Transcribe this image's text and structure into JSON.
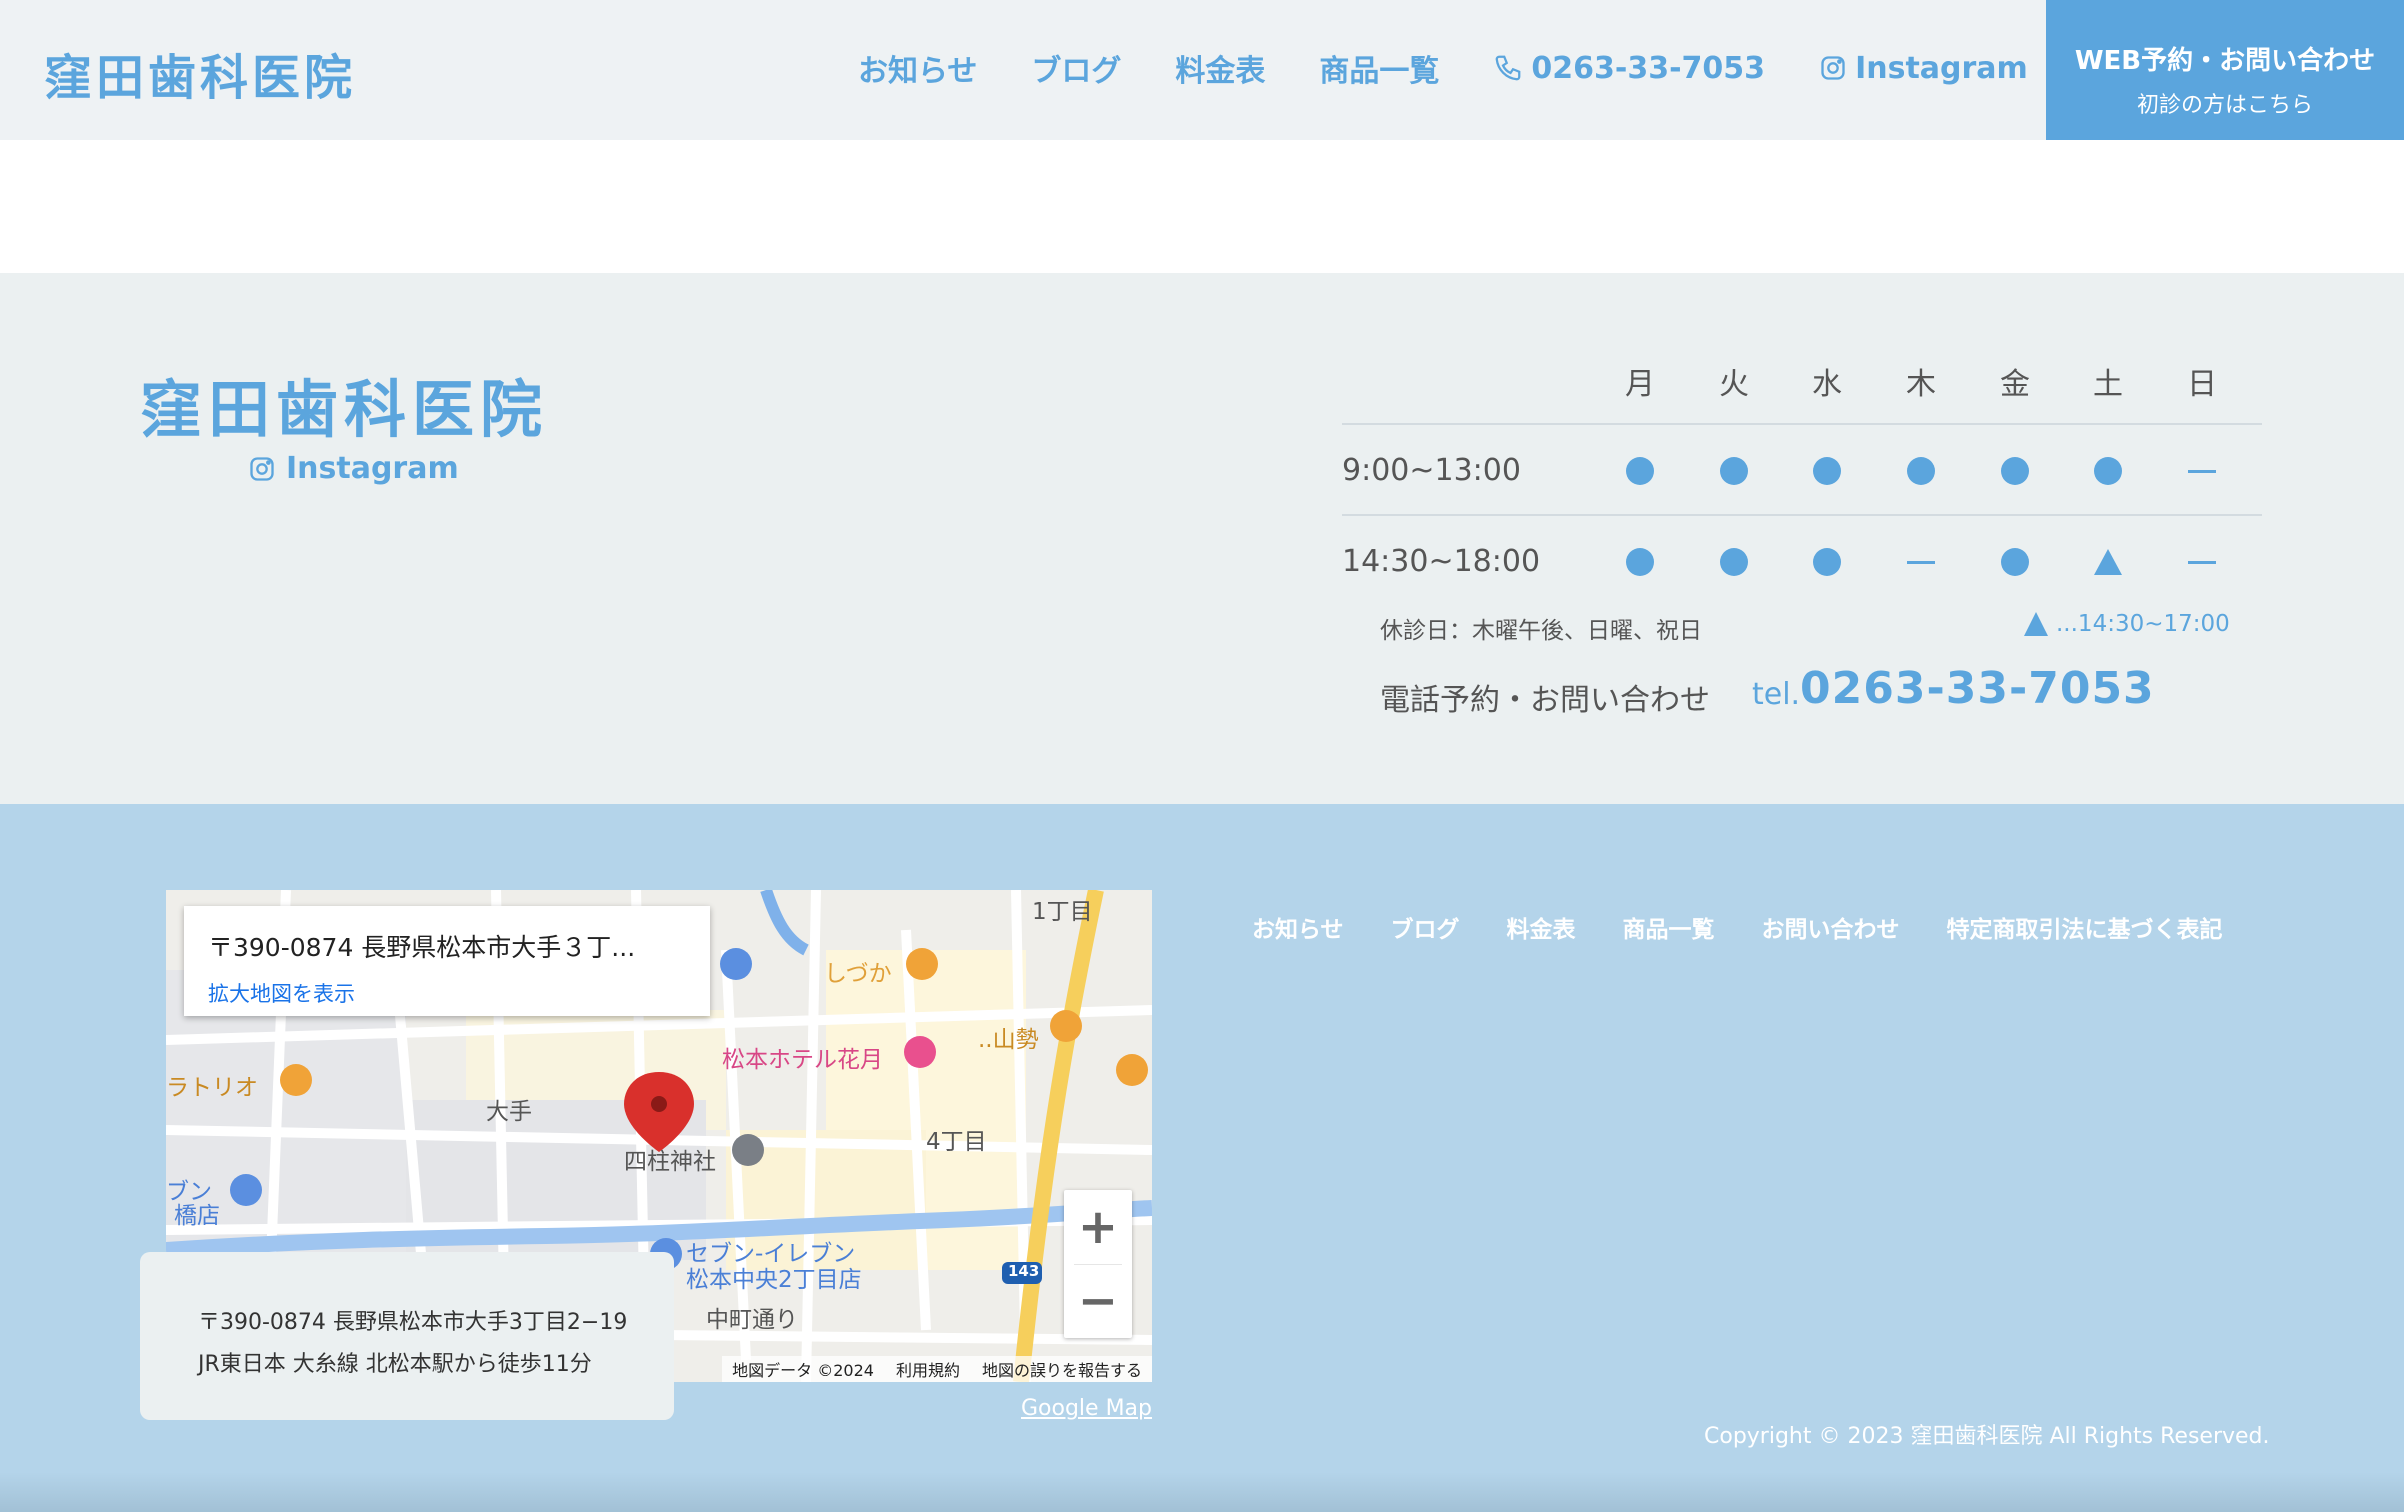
{
  "header": {
    "logo": "窪田歯科医院",
    "nav": {
      "news": "お知らせ",
      "blog": "ブログ",
      "price": "料金表",
      "products": "商品一覧",
      "phone": "0263-33-7053",
      "instagram": "Instagram"
    },
    "cta": {
      "line1": "WEB予約・お問い合わせ",
      "line2": "初診の方はこちら"
    }
  },
  "info": {
    "clinic_name": "窪田歯科医院",
    "instagram": "Instagram",
    "days": [
      "月",
      "火",
      "水",
      "木",
      "金",
      "土",
      "日"
    ],
    "slots": [
      {
        "time": "9:00~13:00",
        "marks": [
          "dot",
          "dot",
          "dot",
          "dot",
          "dot",
          "dot",
          "dash"
        ]
      },
      {
        "time": "14:30~18:00",
        "marks": [
          "dot",
          "dot",
          "dot",
          "dash",
          "dot",
          "triangle",
          "dash"
        ]
      }
    ],
    "closed_note": "休診日：木曜午後、日曜、祝日",
    "triangle_note": "...14:30~17:00",
    "tel_label": "電話予約・お問い合わせ",
    "tel_prefix": "tel.",
    "tel_number": "0263-33-7053"
  },
  "footer": {
    "map": {
      "card_address": "〒390-0874 長野県松本市大手３丁...",
      "enlarge": "拡大地図を表示",
      "labels": {
        "shizuka": "しづか",
        "hotel": "松本ホテル花月",
        "yamasei": "..山勢",
        "bratrio": "ラトリオ",
        "ote": "大手",
        "shrine": "四柱神社",
        "yonchome": "4丁目",
        "itchome": "1丁目",
        "seven": "セブン-イレブン",
        "seven2": "松本中央2丁目店",
        "nakamachi": "中町通り",
        "bun": "ブン",
        "bashi": "橋店",
        "route": "143"
      },
      "zoom_in": "+",
      "zoom_out": "−",
      "attr_data": "地図データ ©2024",
      "attr_terms": "利用規約",
      "attr_report": "地図の誤りを報告する"
    },
    "address_line1": "〒390-0874 長野県松本市大手3丁目2−19",
    "address_line2": "JR東日本 大糸線 北松本駅から徒歩11分",
    "google_map_link": "Google Map",
    "nav": [
      "お知らせ",
      "ブログ",
      "料金表",
      "商品一覧",
      "お問い合わせ",
      "特定商取引法に基づく表記"
    ],
    "copyright": "Copyright © 2023 窪田歯科医院 All Rights Reserved."
  },
  "colors": {
    "accent": "#5ba5dd",
    "header_bg": "#eef2f4",
    "info_bg": "#ebf0f1",
    "footer_bg": "#b4d4ea"
  }
}
